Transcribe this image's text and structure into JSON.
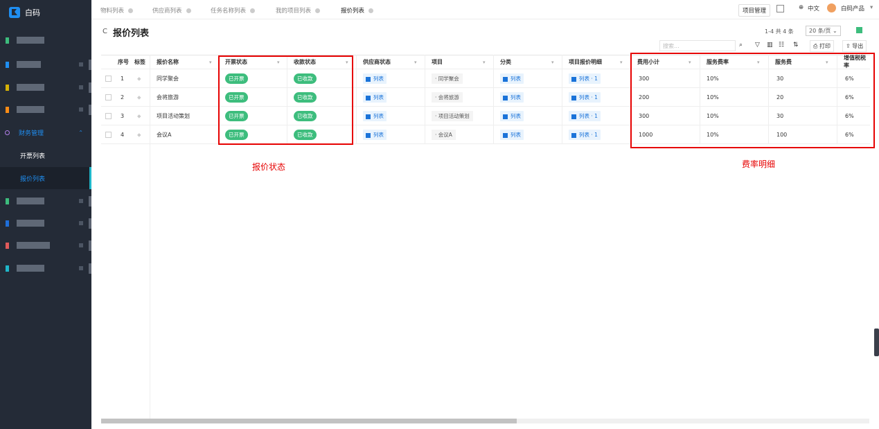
{
  "app": {
    "name": "白码",
    "brand_color": "#1f8ef1"
  },
  "sidebar": {
    "group": {
      "label": "财务管理",
      "expanded_icon": "chevron-up-icon"
    },
    "items": [
      {
        "label": "开票列表"
      },
      {
        "label": "报价列表",
        "active": true
      }
    ]
  },
  "tabs": [
    {
      "label": "物料列表"
    },
    {
      "label": "供应商列表"
    },
    {
      "label": "任务名称列表"
    },
    {
      "label": "我的项目列表"
    },
    {
      "label": "报价列表"
    }
  ],
  "topbar": {
    "project_mgmt": "项目管理",
    "lang": "中文",
    "user": "白码产品"
  },
  "page": {
    "title": "报价列表"
  },
  "pager": {
    "summary": "1-4 共 4 条",
    "page_size": "20 条/页"
  },
  "toolbar": {
    "search_placeholder": "搜索...",
    "print": "打印",
    "export": "导出"
  },
  "table": {
    "columns": [
      "序号",
      "标签",
      "报价名称",
      "开票状态",
      "收款状态",
      "供应商状态",
      "项目",
      "分类",
      "项目报价明细",
      "费用小计",
      "服务费率",
      "服务费",
      "增值税税率"
    ],
    "rows": [
      {
        "no": "1",
        "name": "同学聚会",
        "invoice": "已开票",
        "receipt": "已收款",
        "supplier": "列表",
        "project": "· 同学聚会",
        "category": "列表",
        "detail": "列表 · 1",
        "subtotal": "300",
        "rate": "10%",
        "fee": "30",
        "tax": "6%"
      },
      {
        "no": "2",
        "name": "会将旅游",
        "invoice": "已开票",
        "receipt": "已收款",
        "supplier": "列表",
        "project": "· 会将旅游",
        "category": "列表",
        "detail": "列表 · 1",
        "subtotal": "200",
        "rate": "10%",
        "fee": "20",
        "tax": "6%"
      },
      {
        "no": "3",
        "name": "项目活动策划",
        "invoice": "已开票",
        "receipt": "已收款",
        "supplier": "列表",
        "project": "· 项目活动策划",
        "category": "列表",
        "detail": "列表 · 1",
        "subtotal": "300",
        "rate": "10%",
        "fee": "30",
        "tax": "6%"
      },
      {
        "no": "4",
        "name": "会议A",
        "invoice": "已开票",
        "receipt": "已收款",
        "supplier": "列表",
        "project": "· 会议A",
        "category": "列表",
        "detail": "列表 · 1",
        "subtotal": "1000",
        "rate": "10%",
        "fee": "100",
        "tax": "6%"
      }
    ]
  },
  "annotations": {
    "status": "报价状态",
    "fees": "费率明细"
  }
}
